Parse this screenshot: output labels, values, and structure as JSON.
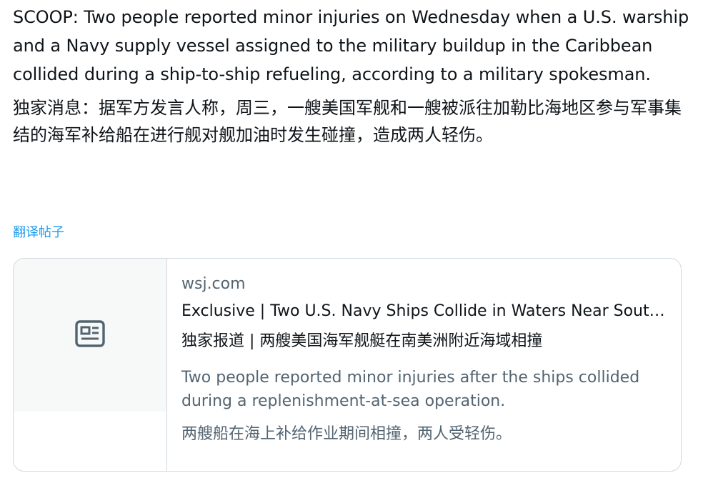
{
  "post": {
    "text_en": "SCOOP: Two people reported minor injuries on Wednesday when a U.S. warship and a Navy supply vessel assigned to the military buildup in the Caribbean collided during a ship-to-ship refueling, according to a military spokesman.",
    "text_zh": "独家消息：据军方发言人称，周三，一艘美国军舰和一艘被派往加勒比海地区参与军事集结的海军补给船在进行舰对舰加油时发生碰撞，造成两人轻伤。",
    "translate_label": "翻译帖子"
  },
  "link_card": {
    "icon": "article-icon",
    "domain": "wsj.com",
    "title": "Exclusive | Two U.S. Navy Ships Collide in Waters Near South America",
    "title_zh": "独家报道 | 两艘美国海军舰艇在南美洲附近海域相撞",
    "description": "Two people reported minor injuries after the ships collided during a replenishment-at-sea operation.",
    "description_zh": "两艘船在海上补给作业期间相撞，两人受轻伤。"
  },
  "colors": {
    "text": "#0f1419",
    "muted": "#536471",
    "link": "#1d9bf0",
    "border": "#cfd9de",
    "thumb_bg": "#f7f9f9"
  }
}
